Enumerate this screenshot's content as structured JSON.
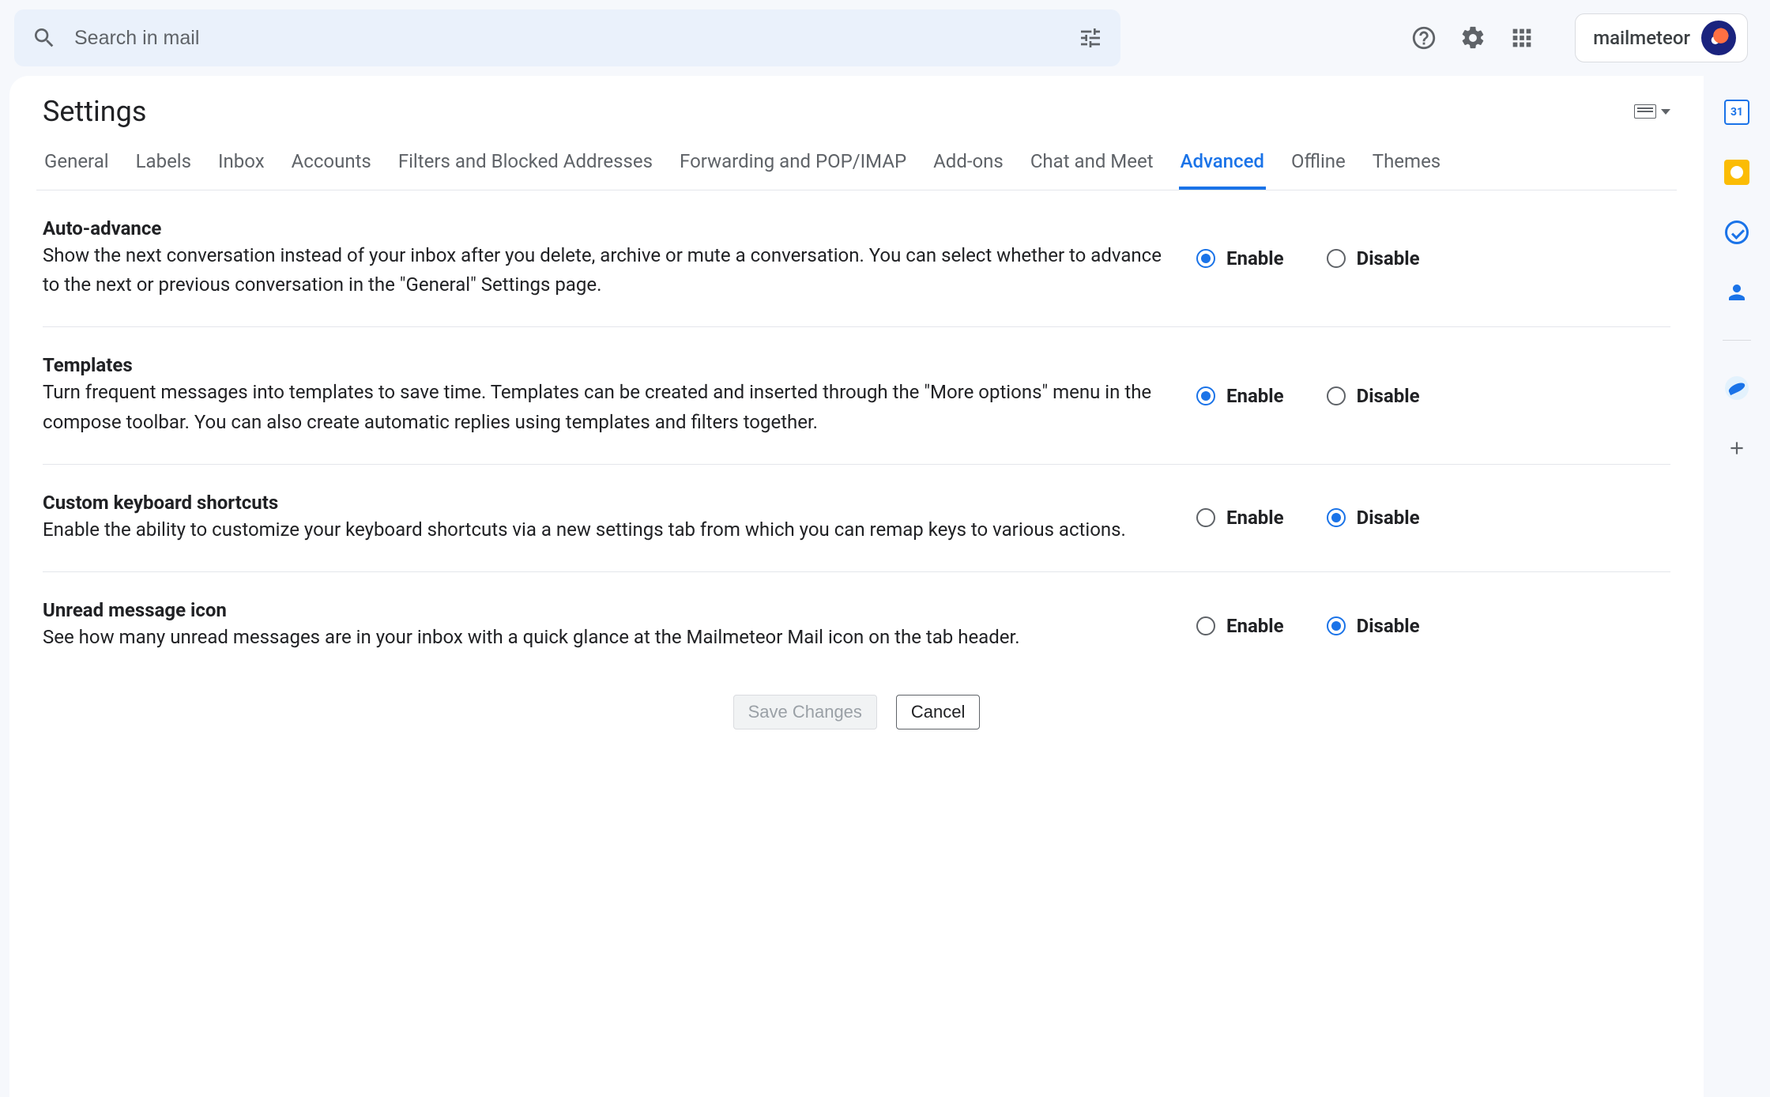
{
  "search": {
    "placeholder": "Search in mail"
  },
  "brand": {
    "name": "mailmeteor"
  },
  "page": {
    "title": "Settings"
  },
  "tabs": [
    {
      "label": "General",
      "active": false
    },
    {
      "label": "Labels",
      "active": false
    },
    {
      "label": "Inbox",
      "active": false
    },
    {
      "label": "Accounts",
      "active": false
    },
    {
      "label": "Filters and Blocked Addresses",
      "active": false
    },
    {
      "label": "Forwarding and POP/IMAP",
      "active": false
    },
    {
      "label": "Add-ons",
      "active": false
    },
    {
      "label": "Chat and Meet",
      "active": false
    },
    {
      "label": "Advanced",
      "active": true
    },
    {
      "label": "Offline",
      "active": false
    },
    {
      "label": "Themes",
      "active": false
    }
  ],
  "radio_labels": {
    "enable": "Enable",
    "disable": "Disable"
  },
  "settings": [
    {
      "title": "Auto-advance",
      "desc": "Show the next conversation instead of your inbox after you delete, archive or mute a conversation. You can select whether to advance to the next or previous conversation in the \"General\" Settings page.",
      "value": "enable"
    },
    {
      "title": "Templates",
      "desc": "Turn frequent messages into templates to save time. Templates can be created and inserted through the \"More options\" menu in the compose toolbar. You can also create automatic replies using templates and filters together.",
      "value": "enable"
    },
    {
      "title": "Custom keyboard shortcuts",
      "desc": "Enable the ability to customize your keyboard shortcuts via a new settings tab from which you can remap keys to various actions.",
      "value": "disable"
    },
    {
      "title": "Unread message icon",
      "desc": "See how many unread messages are in your inbox with a quick glance at the Mailmeteor Mail icon on the tab header.",
      "value": "disable"
    }
  ],
  "actions": {
    "save": "Save Changes",
    "cancel": "Cancel"
  },
  "rail": {
    "calendar": "calendar",
    "keep": "keep",
    "tasks": "tasks",
    "contacts": "contacts",
    "mailmeteor": "mailmeteor",
    "add": "add"
  }
}
